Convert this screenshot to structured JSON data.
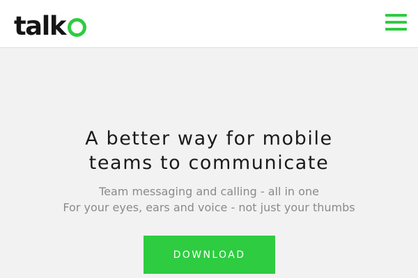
{
  "header": {
    "logo_text_main": "talk",
    "logo_accent_color": "#2ecc40",
    "menu_icon": "hamburger-menu-icon"
  },
  "hero": {
    "headline_line1": "A better way for mobile",
    "headline_line2": "teams to communicate",
    "subtext_line1": "Team messaging and calling - all in one",
    "subtext_line2": "For your eyes, ears and voice - not just your thumbs",
    "download_label": "DOWNLOAD"
  },
  "colors": {
    "accent": "#2ecc40",
    "background": "#f2f2f2",
    "header_background": "#ffffff"
  }
}
